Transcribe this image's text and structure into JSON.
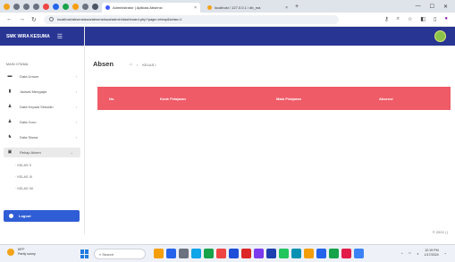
{
  "browser": {
    "tabs": [
      {
        "title": "Administrator | Aplikasi Absensi",
        "active": true,
        "color": "#3d5afe"
      },
      {
        "title": "localhost / 127.0.0.1 / db_ma",
        "active": false,
        "color": "#f2a31a"
      }
    ],
    "url": "localhost/absensiswa/absensiswa/admin/dashboard.php?page=rekap&kelas=1",
    "colors": {
      "tabstrip": "#dfe3ea"
    }
  },
  "sidebar": {
    "brand": "SMK WIRA KESUMA",
    "heading": "MAIN OTAMA",
    "items": [
      {
        "label": "Data Umum",
        "icon": "folder-icon"
      },
      {
        "label": "Jadwal Mengajar",
        "icon": "trash-icon"
      },
      {
        "label": "Data Kepala Sekolah",
        "icon": "user-icon"
      },
      {
        "label": "Data Guru",
        "icon": "user-icon"
      },
      {
        "label": "Data Siswa",
        "icon": "users-icon"
      },
      {
        "label": "Rekap Absen",
        "icon": "calendar-icon"
      }
    ],
    "subitems": [
      "KELAS X",
      "KELAS XI",
      "KELAS XII"
    ],
    "logout": "Logout"
  },
  "main": {
    "title": "Absen",
    "breadcrumb": "KELAS I",
    "columns": [
      "No.",
      "Kode Pelajaran",
      "Mata Pelajaran",
      "Absensi"
    ],
    "footer": "© 2024 | |",
    "colors": {
      "table_header": "#ef5b67",
      "topbar": "#283593"
    }
  },
  "taskbar": {
    "weather_temp": "69°F",
    "weather_desc": "Partly sunny",
    "search": "Search",
    "time": "12:19 PM",
    "date": "1/17/2024"
  }
}
